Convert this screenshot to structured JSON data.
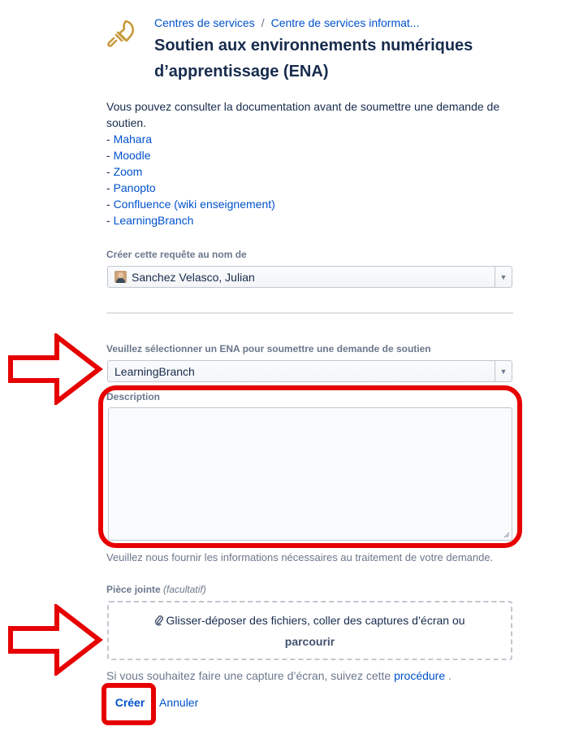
{
  "header": {
    "breadcrumb": [
      "Centres de services",
      "Centre de services informat..."
    ],
    "breadcrumb_separator": "/",
    "title": "Soutien aux environnements numériques d’apprentissage (ENA)",
    "logo_icon": "lightbulb-icon"
  },
  "intro": {
    "text": "Vous pouvez consulter la documentation avant de soumettre une demande de soutien.",
    "links": [
      "Mahara",
      "Moodle",
      "Zoom",
      "Panopto",
      "Confluence (wiki enseignement)",
      "LearningBranch"
    ],
    "prefix": "- "
  },
  "form": {
    "requester_label": "Créer cette requête au nom de",
    "requester_value": "Sanchez Velasco, Julian",
    "ena_label": "Veuillez sélectionner un ENA pour soumettre une demande de soutien",
    "ena_value": "LearningBranch",
    "description_label": "Description",
    "description_value": "",
    "description_help": "Veuillez nous fournir les informations nécessaires au traitement de votre demande.",
    "attachment_label": "Pièce jointe",
    "attachment_optional": "(facultatif)",
    "dropzone_text": "Glisser-déposer des fichiers, coller des captures d’écran ou",
    "dropzone_browse": "parcourir",
    "screenshot_prefix": "Si vous souhaitez faire une capture d’écran, suivez cette",
    "screenshot_link": "procédure",
    "screenshot_suffix": ".",
    "create_label": "Créer",
    "cancel_label": "Annuler"
  },
  "colors": {
    "link": "#0052cc",
    "annotation": "#e60000",
    "logo": "#c79a3a"
  }
}
